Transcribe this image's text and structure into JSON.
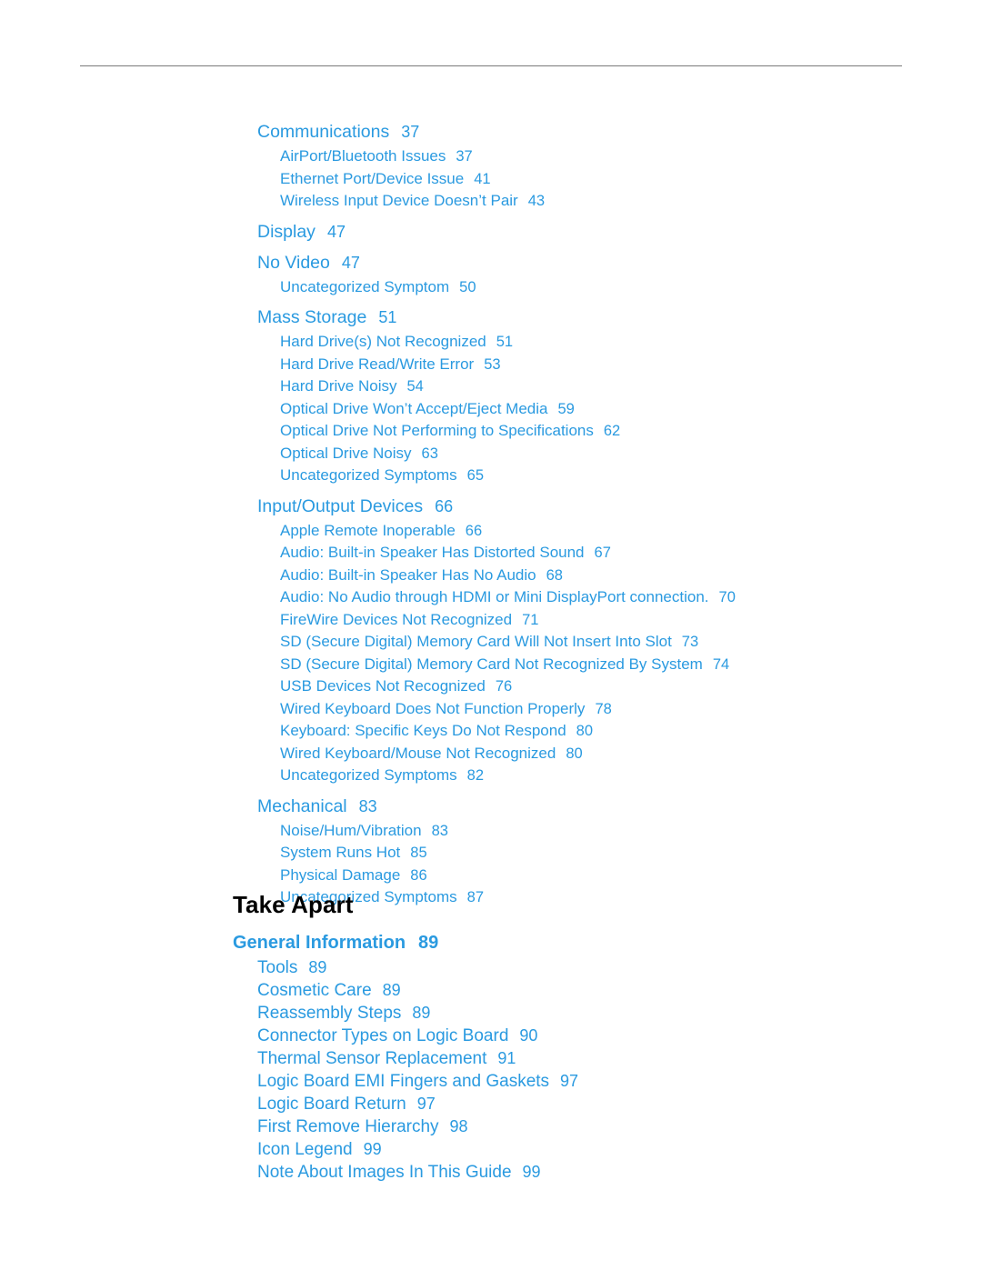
{
  "colors": {
    "link_blue": "#2a9ae0",
    "text_black": "#000000",
    "rule_gray": "#7a7a7a"
  },
  "toc": {
    "entries": [
      {
        "level": 1,
        "label": "Communications",
        "page": "37"
      },
      {
        "level": 2,
        "label": "AirPort/Bluetooth Issues",
        "page": "37"
      },
      {
        "level": 2,
        "label": "Ethernet Port/Device Issue",
        "page": "41"
      },
      {
        "level": 2,
        "label": "Wireless Input Device Doesn’t Pair",
        "page": "43"
      },
      {
        "level": 1,
        "label": "Display",
        "page": "47"
      },
      {
        "level": 1,
        "label": "No Video",
        "page": "47"
      },
      {
        "level": 2,
        "label": "Uncategorized Symptom",
        "page": "50"
      },
      {
        "level": 1,
        "label": "Mass Storage",
        "page": "51"
      },
      {
        "level": 2,
        "label": "Hard Drive(s) Not Recognized",
        "page": "51"
      },
      {
        "level": 2,
        "label": "Hard Drive Read/Write Error",
        "page": "53"
      },
      {
        "level": 2,
        "label": "Hard Drive Noisy",
        "page": "54"
      },
      {
        "level": 2,
        "label": "Optical Drive Won’t Accept/Eject Media",
        "page": "59"
      },
      {
        "level": 2,
        "label": "Optical Drive Not Performing to Specifications",
        "page": "62"
      },
      {
        "level": 2,
        "label": "Optical Drive Noisy",
        "page": "63"
      },
      {
        "level": 2,
        "label": "Uncategorized Symptoms",
        "page": "65"
      },
      {
        "level": 1,
        "label": "Input/Output Devices",
        "page": "66"
      },
      {
        "level": 2,
        "label": "Apple Remote Inoperable",
        "page": "66"
      },
      {
        "level": 2,
        "label": "Audio: Built-in Speaker Has Distorted Sound",
        "page": "67"
      },
      {
        "level": 2,
        "label": "Audio: Built-in Speaker Has No Audio",
        "page": "68"
      },
      {
        "level": 2,
        "label": "Audio: No Audio through HDMI or Mini DisplayPort connection.",
        "page": "70"
      },
      {
        "level": 2,
        "label": "FireWire Devices Not Recognized",
        "page": "71"
      },
      {
        "level": 2,
        "label": "SD (Secure Digital) Memory Card Will Not Insert Into Slot",
        "page": "73"
      },
      {
        "level": 2,
        "label": "SD (Secure Digital) Memory Card Not Recognized By System",
        "page": "74"
      },
      {
        "level": 2,
        "label": "USB Devices Not Recognized",
        "page": "76"
      },
      {
        "level": 2,
        "label": "Wired Keyboard Does Not Function Properly",
        "page": "78"
      },
      {
        "level": 2,
        "label": "Keyboard: Specific Keys Do Not Respond",
        "page": "80"
      },
      {
        "level": 2,
        "label": "Wired Keyboard/Mouse Not Recognized",
        "page": "80"
      },
      {
        "level": 2,
        "label": "Uncategorized Symptoms",
        "page": "82"
      },
      {
        "level": 1,
        "label": "Mechanical",
        "page": "83"
      },
      {
        "level": 2,
        "label": "Noise/Hum/Vibration",
        "page": "83"
      },
      {
        "level": 2,
        "label": "System Runs Hot",
        "page": "85"
      },
      {
        "level": 2,
        "label": "Physical Damage",
        "page": "86"
      },
      {
        "level": 2,
        "label": "Uncategorized Symptoms",
        "page": "87"
      }
    ]
  },
  "chapter": {
    "title": "Take Apart",
    "section_label": "General Information",
    "section_page": "89",
    "entries": [
      {
        "label": "Tools",
        "page": "89"
      },
      {
        "label": "Cosmetic Care",
        "page": "89"
      },
      {
        "label": "Reassembly Steps",
        "page": "89"
      },
      {
        "label": "Connector Types on Logic Board",
        "page": "90"
      },
      {
        "label": "Thermal Sensor Replacement",
        "page": "91"
      },
      {
        "label": "Logic Board EMI Fingers and Gaskets",
        "page": "97"
      },
      {
        "label": "Logic Board Return",
        "page": "97"
      },
      {
        "label": "First Remove Hierarchy",
        "page": "98"
      },
      {
        "label": "Icon Legend",
        "page": "99"
      },
      {
        "label": "Note About Images In This Guide",
        "page": "99"
      }
    ]
  }
}
